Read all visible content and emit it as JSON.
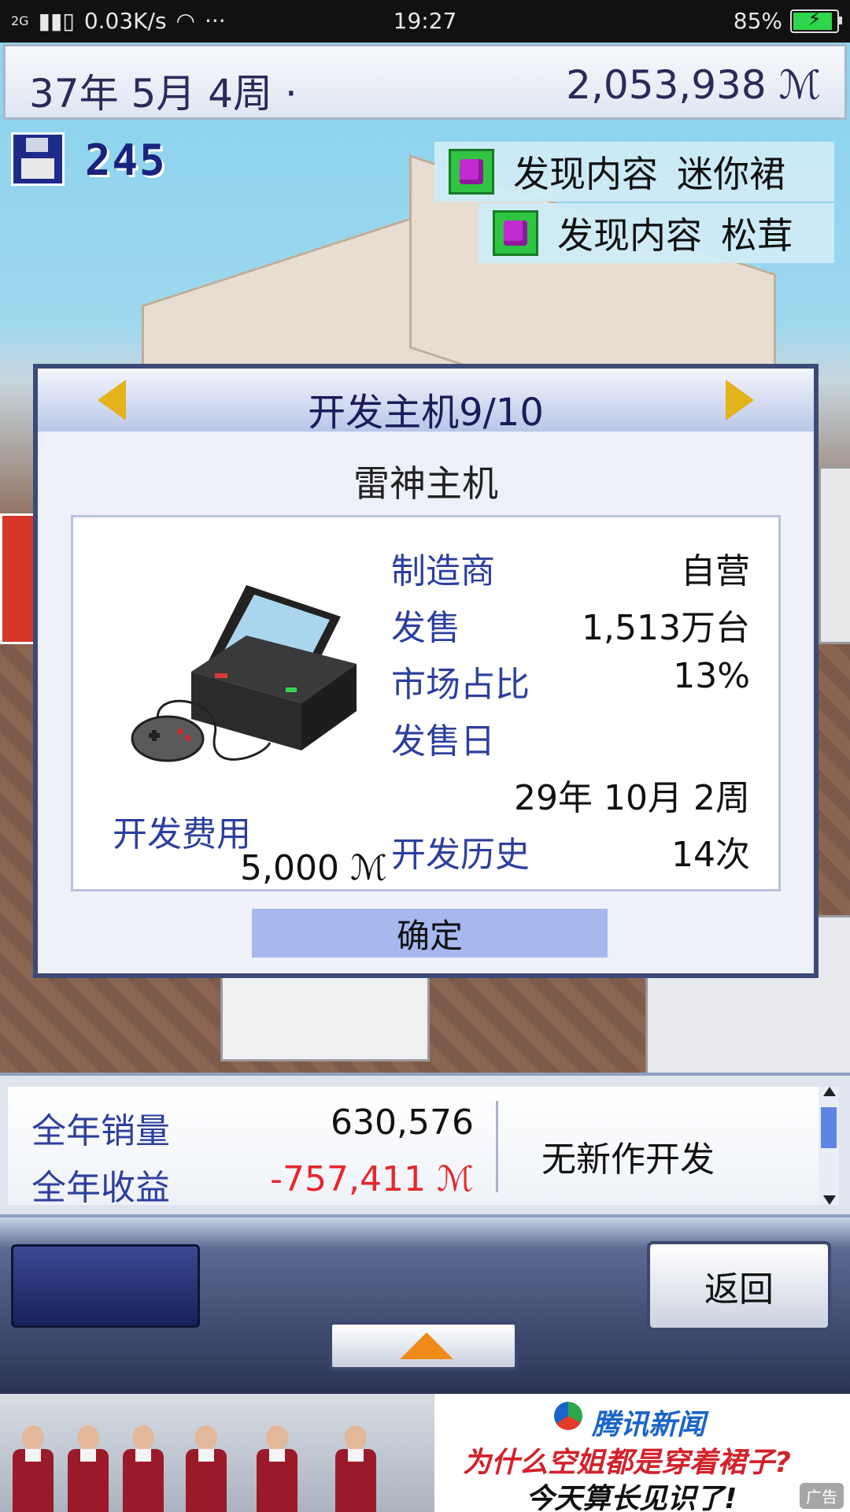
{
  "status_bar": {
    "network": "2G",
    "speed": "0.03K/s",
    "more": "···",
    "time": "19:27",
    "battery": "85%"
  },
  "header": {
    "date": "37年 5月 4周 ·",
    "money": "2,053,938 ℳ"
  },
  "hud": {
    "save_count": "245",
    "notifications": [
      {
        "label": "发现内容",
        "item": "迷你裙"
      },
      {
        "label": "发现内容",
        "item": "松茸"
      }
    ]
  },
  "dialog": {
    "title": "开发主机9/10",
    "console_name": "雷神主机",
    "manufacturer_label": "制造商",
    "manufacturer_value": "自营",
    "sales_label": "发售",
    "sales_value": "1,513万台",
    "share_label": "市场占比",
    "share_value": "13%",
    "release_label": "发售日",
    "release_value": "29年 10月 2周",
    "history_label": "开发历史",
    "history_value": "14次",
    "cost_label": "开发费用",
    "cost_value": "5,000 ℳ",
    "confirm_label": "确定"
  },
  "stats": {
    "annual_sales_label": "全年销量",
    "annual_sales_value": "630,576",
    "annual_profit_label": "全年收益",
    "annual_profit_value": "-757,411 ℳ",
    "status_text": "无新作开发"
  },
  "controls": {
    "back_label": "返回"
  },
  "ad": {
    "brand": "腾讯新闻",
    "line1": "为什么空姐都是穿着裙子?",
    "line2": "今天算长见识了!",
    "tag": "广告"
  },
  "colors": {
    "label_blue": "#2c3f9e",
    "negative_red": "#e8262a",
    "confirm_button": "#a6b8ee",
    "accent_arrow": "#e4b21a"
  }
}
